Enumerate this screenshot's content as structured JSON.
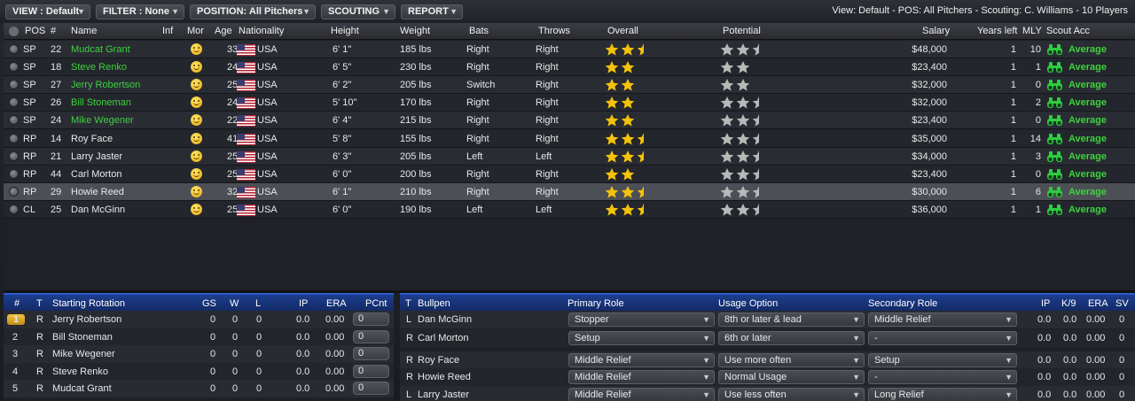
{
  "toolbar": {
    "view": "VIEW : Default",
    "filter": "FILTER : None",
    "position": "POSITION: All Pitchers",
    "scouting": "SCOUTING",
    "report": "REPORT",
    "info": "View: Default - POS: All Pitchers - Scouting: C. Williams - 10 Players"
  },
  "columns": {
    "pos": "POS",
    "num": "#",
    "name": "Name",
    "inf": "Inf",
    "mor": "Mor",
    "age": "Age",
    "nat": "Nationality",
    "height": "Height",
    "weight": "Weight",
    "bats": "Bats",
    "throws": "Throws",
    "overall": "Overall",
    "potential": "Potential",
    "salary": "Salary",
    "years": "Years left",
    "mly": "MLY",
    "scout": "Scout Acc"
  },
  "colors": {
    "green_name": "#3ed23e",
    "star": "#f3c20d",
    "grey_star": "#b8b8b8",
    "panel_header": "#1d3e8e"
  },
  "players": [
    {
      "pos": "SP",
      "num": "22",
      "name": "Mudcat Grant",
      "green": true,
      "age": "33",
      "nat": "USA",
      "height": "6' 1\"",
      "weight": "185 lbs",
      "bats": "Right",
      "throws": "Right",
      "overall": 2.5,
      "potential": 2.5,
      "salary": "$48,000",
      "years": "1",
      "mly": "10",
      "scout": "Average"
    },
    {
      "pos": "SP",
      "num": "18",
      "name": "Steve Renko",
      "green": true,
      "age": "24",
      "nat": "USA",
      "height": "6' 5\"",
      "weight": "230 lbs",
      "bats": "Right",
      "throws": "Right",
      "overall": 2,
      "potential": 2,
      "salary": "$23,400",
      "years": "1",
      "mly": "1",
      "scout": "Average"
    },
    {
      "pos": "SP",
      "num": "27",
      "name": "Jerry Robertson",
      "green": true,
      "age": "25",
      "nat": "USA",
      "height": "6' 2\"",
      "weight": "205 lbs",
      "bats": "Switch",
      "throws": "Right",
      "overall": 2,
      "potential": 2,
      "salary": "$32,000",
      "years": "1",
      "mly": "0",
      "scout": "Average"
    },
    {
      "pos": "SP",
      "num": "26",
      "name": "Bill Stoneman",
      "green": true,
      "age": "24",
      "nat": "USA",
      "height": "5' 10\"",
      "weight": "170 lbs",
      "bats": "Right",
      "throws": "Right",
      "overall": 2,
      "potential": 2.5,
      "salary": "$32,000",
      "years": "1",
      "mly": "2",
      "scout": "Average"
    },
    {
      "pos": "SP",
      "num": "24",
      "name": "Mike Wegener",
      "green": true,
      "age": "22",
      "nat": "USA",
      "height": "6' 4\"",
      "weight": "215 lbs",
      "bats": "Right",
      "throws": "Right",
      "overall": 2,
      "potential": 2.5,
      "salary": "$23,400",
      "years": "1",
      "mly": "0",
      "scout": "Average"
    },
    {
      "pos": "RP",
      "num": "14",
      "name": "Roy Face",
      "green": false,
      "age": "41",
      "nat": "USA",
      "height": "5' 8\"",
      "weight": "155 lbs",
      "bats": "Right",
      "throws": "Right",
      "overall": 2.5,
      "potential": 2.5,
      "salary": "$35,000",
      "years": "1",
      "mly": "14",
      "scout": "Average"
    },
    {
      "pos": "RP",
      "num": "21",
      "name": "Larry Jaster",
      "green": false,
      "age": "25",
      "nat": "USA",
      "height": "6' 3\"",
      "weight": "205 lbs",
      "bats": "Left",
      "throws": "Left",
      "overall": 2.5,
      "potential": 2.5,
      "salary": "$34,000",
      "years": "1",
      "mly": "3",
      "scout": "Average"
    },
    {
      "pos": "RP",
      "num": "44",
      "name": "Carl Morton",
      "green": false,
      "age": "25",
      "nat": "USA",
      "height": "6' 0\"",
      "weight": "200 lbs",
      "bats": "Right",
      "throws": "Right",
      "overall": 2,
      "potential": 2.5,
      "salary": "$23,400",
      "years": "1",
      "mly": "0",
      "scout": "Average"
    },
    {
      "pos": "RP",
      "num": "29",
      "name": "Howie Reed",
      "green": false,
      "age": "32",
      "nat": "USA",
      "height": "6' 1\"",
      "weight": "210 lbs",
      "bats": "Right",
      "throws": "Right",
      "overall": 2.5,
      "potential": 2.5,
      "salary": "$30,000",
      "years": "1",
      "mly": "6",
      "scout": "Average"
    },
    {
      "pos": "CL",
      "num": "25",
      "name": "Dan McGinn",
      "green": false,
      "age": "25",
      "nat": "USA",
      "height": "6' 0\"",
      "weight": "190 lbs",
      "bats": "Left",
      "throws": "Left",
      "overall": 2.5,
      "potential": 2.5,
      "salary": "$36,000",
      "years": "1",
      "mly": "1",
      "scout": "Average"
    }
  ],
  "rotation": {
    "headers": {
      "num": "#",
      "t": "T",
      "title": "Starting Rotation",
      "gs": "GS",
      "w": "W",
      "l": "L",
      "ip": "IP",
      "era": "ERA",
      "pcnt": "PCnt"
    },
    "rows": [
      {
        "num": "1",
        "t": "R",
        "name": "Jerry Robertson",
        "gs": "0",
        "w": "0",
        "l": "0",
        "ip": "0.0",
        "era": "0.00",
        "pcnt": "0"
      },
      {
        "num": "2",
        "t": "R",
        "name": "Bill Stoneman",
        "gs": "0",
        "w": "0",
        "l": "0",
        "ip": "0.0",
        "era": "0.00",
        "pcnt": "0"
      },
      {
        "num": "3",
        "t": "R",
        "name": "Mike Wegener",
        "gs": "0",
        "w": "0",
        "l": "0",
        "ip": "0.0",
        "era": "0.00",
        "pcnt": "0"
      },
      {
        "num": "4",
        "t": "R",
        "name": "Steve Renko",
        "gs": "0",
        "w": "0",
        "l": "0",
        "ip": "0.0",
        "era": "0.00",
        "pcnt": "0"
      },
      {
        "num": "5",
        "t": "R",
        "name": "Mudcat Grant",
        "gs": "0",
        "w": "0",
        "l": "0",
        "ip": "0.0",
        "era": "0.00",
        "pcnt": "0"
      }
    ]
  },
  "bullpen": {
    "headers": {
      "t": "T",
      "title": "Bullpen",
      "primary": "Primary Role",
      "usage": "Usage Option",
      "secondary": "Secondary Role",
      "ip": "IP",
      "k9": "K/9",
      "era": "ERA",
      "sv": "SV"
    },
    "rows": [
      {
        "t": "L",
        "name": "Dan McGinn",
        "primary": "Stopper",
        "usage": "8th or later & lead",
        "secondary": "Middle Relief",
        "ip": "0.0",
        "k9": "0.0",
        "era": "0.00",
        "sv": "0"
      },
      {
        "t": "R",
        "name": "Carl Morton",
        "primary": "Setup",
        "usage": "6th or later",
        "secondary": "-",
        "ip": "0.0",
        "k9": "0.0",
        "era": "0.00",
        "sv": "0"
      },
      {
        "t": "R",
        "name": "Roy Face",
        "primary": "Middle Relief",
        "usage": "Use more often",
        "secondary": "Setup",
        "ip": "0.0",
        "k9": "0.0",
        "era": "0.00",
        "sv": "0"
      },
      {
        "t": "R",
        "name": "Howie Reed",
        "primary": "Middle Relief",
        "usage": "Normal Usage",
        "secondary": "-",
        "ip": "0.0",
        "k9": "0.0",
        "era": "0.00",
        "sv": "0"
      },
      {
        "t": "L",
        "name": "Larry Jaster",
        "primary": "Middle Relief",
        "usage": "Use less often",
        "secondary": "Long Relief",
        "ip": "0.0",
        "k9": "0.0",
        "era": "0.00",
        "sv": "0"
      }
    ]
  }
}
